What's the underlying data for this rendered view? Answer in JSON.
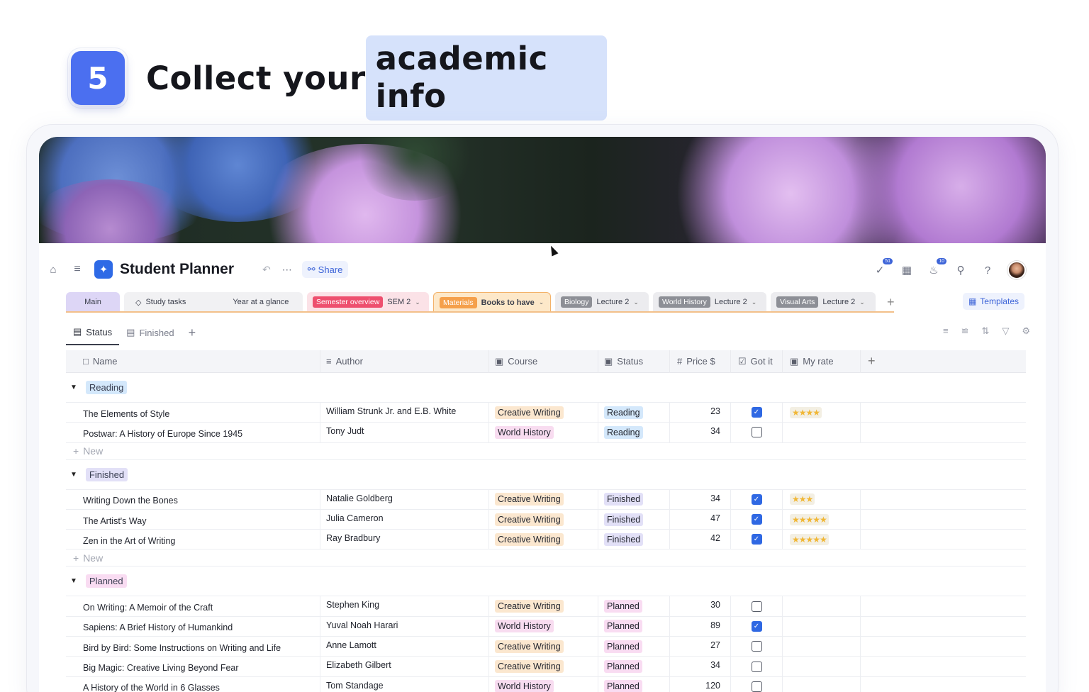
{
  "headline": {
    "step": "5",
    "text_plain": "Collect your",
    "text_highlight": "academic info"
  },
  "app": {
    "title": "Student Planner",
    "share_label": "Share",
    "notifications": {
      "tasks_badge": "51",
      "bell_badge": "10"
    },
    "templates_label": "Templates"
  },
  "tabs": [
    {
      "label": "Main"
    },
    {
      "label": "Study tasks"
    },
    {
      "label": "Year at a glance"
    },
    {
      "pill": "Semester overview",
      "sub": "SEM 2",
      "pill_color": "#ee4f6e"
    },
    {
      "pill": "Materials",
      "sub": "Books to have",
      "pill_color": "#f5a04b"
    },
    {
      "pill": "Biology",
      "sub": "Lecture 2",
      "pill_color": "#8d8f96"
    },
    {
      "pill": "World History",
      "sub": "Lecture 2",
      "pill_color": "#8d8f96"
    },
    {
      "pill": "Visual Arts",
      "sub": "Lecture 2",
      "pill_color": "#8d8f96"
    }
  ],
  "views": {
    "status": "Status",
    "finished": "Finished"
  },
  "columns": {
    "name": "Name",
    "author": "Author",
    "course": "Course",
    "status": "Status",
    "price": "Price $",
    "got": "Got it",
    "rate": "My rate"
  },
  "new_label": "New",
  "groups": {
    "reading": {
      "label": "Reading",
      "rows": [
        {
          "name": "The Elements of Style",
          "author": "William Strunk Jr. and E.B. White",
          "course": "Creative Writing",
          "status": "Reading",
          "price": "23",
          "got": true,
          "rating": 4
        },
        {
          "name": "Postwar: A History of Europe Since 1945",
          "author": "Tony Judt",
          "course": "World History",
          "status": "Reading",
          "price": "34",
          "got": false,
          "rating": 0
        }
      ]
    },
    "finished": {
      "label": "Finished",
      "rows": [
        {
          "name": "Writing Down the Bones",
          "author": "Natalie Goldberg",
          "course": "Creative Writing",
          "status": "Finished",
          "price": "34",
          "got": true,
          "rating": 3
        },
        {
          "name": "The Artist's Way",
          "author": "Julia Cameron",
          "course": "Creative Writing",
          "status": "Finished",
          "price": "47",
          "got": true,
          "rating": 5
        },
        {
          "name": "Zen in the Art of Writing",
          "author": "Ray Bradbury",
          "course": "Creative Writing",
          "status": "Finished",
          "price": "42",
          "got": true,
          "rating": 5
        }
      ]
    },
    "planned": {
      "label": "Planned",
      "rows": [
        {
          "name": "On Writing: A Memoir of the Craft",
          "author": "Stephen King",
          "course": "Creative Writing",
          "status": "Planned",
          "price": "30",
          "got": false,
          "rating": 0
        },
        {
          "name": "Sapiens: A Brief History of Humankind",
          "author": "Yuval Noah Harari",
          "course": "World History",
          "status": "Planned",
          "price": "89",
          "got": true,
          "rating": 0
        },
        {
          "name": "Bird by Bird: Some Instructions on Writing and Life",
          "author": "Anne Lamott",
          "course": "Creative Writing",
          "status": "Planned",
          "price": "27",
          "got": false,
          "rating": 0
        },
        {
          "name": "Big Magic: Creative Living Beyond Fear",
          "author": "Elizabeth Gilbert",
          "course": "Creative Writing",
          "status": "Planned",
          "price": "34",
          "got": false,
          "rating": 0
        },
        {
          "name": "A History of the World in 6 Glasses",
          "author": "Tom Standage",
          "course": "World History",
          "status": "Planned",
          "price": "120",
          "got": false,
          "rating": 0
        }
      ]
    }
  },
  "colors": {
    "accent": "#4b6ff0",
    "creative_writing_tag": "#fbe7cf",
    "world_history_tag": "#f8dcf0",
    "reading_tag": "#d4e8fb",
    "finished_tag": "#e2e0f7",
    "planned_tag": "#f9dcf2"
  }
}
